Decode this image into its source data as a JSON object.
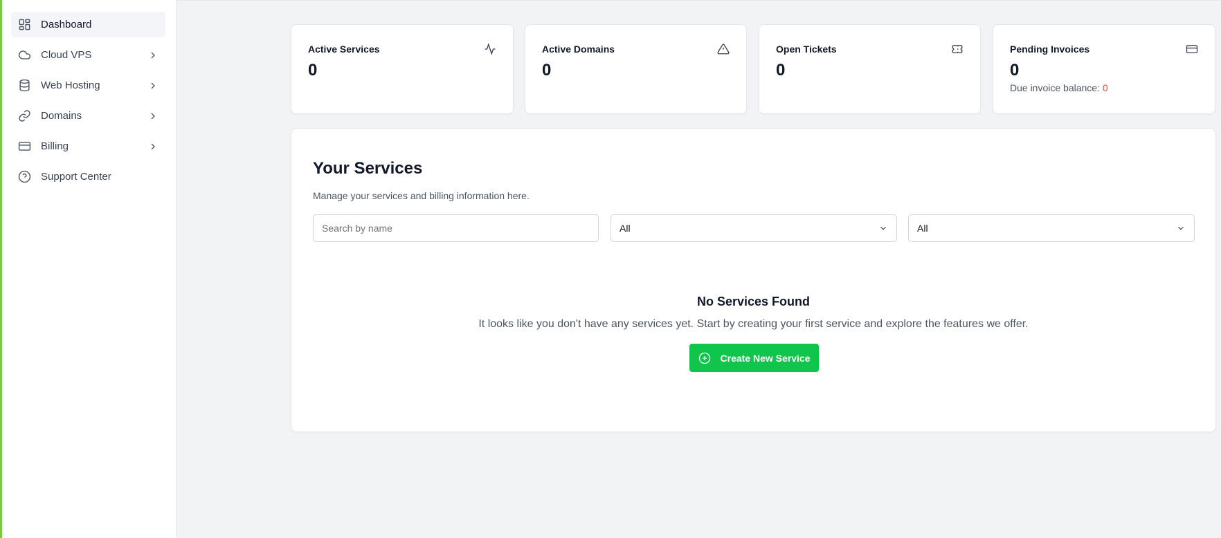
{
  "sidebar": {
    "items": [
      {
        "label": "Dashboard",
        "icon": "dashboard-grid-icon",
        "active": true
      },
      {
        "label": "Cloud VPS",
        "icon": "cloud-icon",
        "expandable": true
      },
      {
        "label": "Web Hosting",
        "icon": "database-icon",
        "expandable": true
      },
      {
        "label": "Domains",
        "icon": "link-icon",
        "expandable": true
      },
      {
        "label": "Billing",
        "icon": "credit-card-icon",
        "expandable": true
      },
      {
        "label": "Support Center",
        "icon": "help-circle-icon"
      }
    ]
  },
  "stats": [
    {
      "title": "Active Services",
      "value": "0",
      "icon": "activity-icon"
    },
    {
      "title": "Active Domains",
      "value": "0",
      "icon": "warning-triangle-icon"
    },
    {
      "title": "Open Tickets",
      "value": "0",
      "icon": "ticket-icon"
    },
    {
      "title": "Pending Invoices",
      "value": "0",
      "icon": "credit-card-icon",
      "sub_label": "Due invoice balance:",
      "sub_value": "0"
    }
  ],
  "services": {
    "title": "Your Services",
    "subtitle": "Manage your services and billing information here.",
    "search_placeholder": "Search by name",
    "filter1": "All",
    "filter2": "All",
    "empty_title": "No Services Found",
    "empty_text": "It looks like you don't have any services yet. Start by creating your first service and explore the features we offer.",
    "create_label": "Create New Service"
  },
  "colors": {
    "accent": "#7ac943",
    "primary_button": "#10c44c",
    "balance_value": "#ef4444"
  }
}
